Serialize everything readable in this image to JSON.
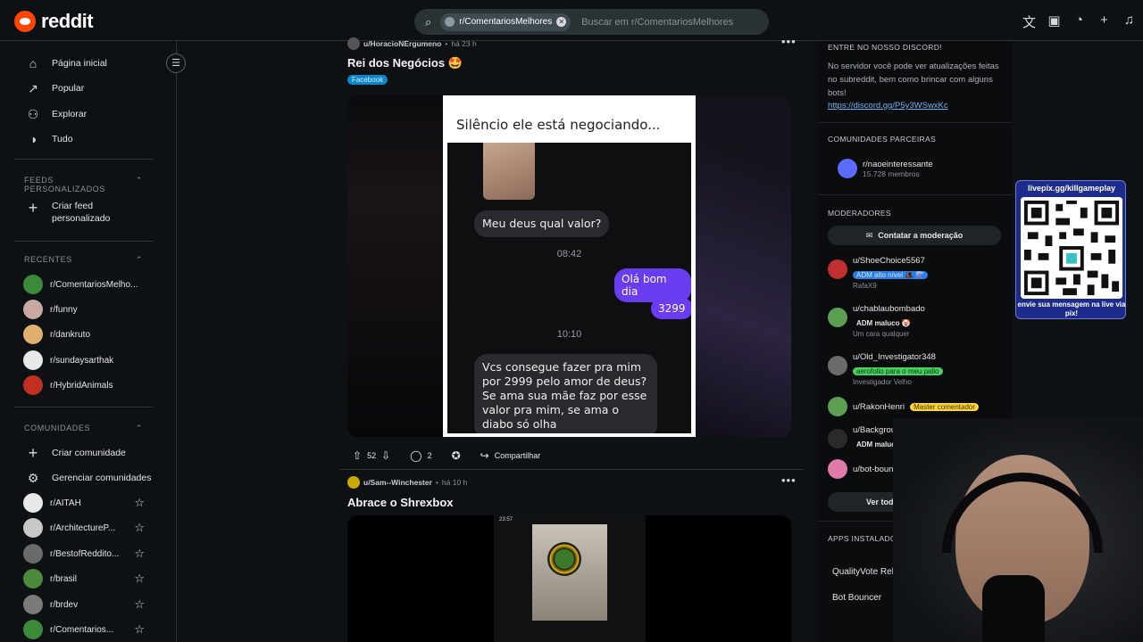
{
  "topbar": {
    "brand": "reddit",
    "search_chip": "r/ComentariosMelhores",
    "search_placeholder": "Buscar em r/ComentariosMelhores"
  },
  "sidebar": {
    "nav": [
      {
        "label": "Página inicial",
        "icon": "home-icon"
      },
      {
        "label": "Popular",
        "icon": "popular-icon"
      },
      {
        "label": "Explorar",
        "icon": "explore-icon"
      },
      {
        "label": "Tudo",
        "icon": "all-icon"
      }
    ],
    "feeds_title": "FEEDS PERSONALIZADOS",
    "create_feed": "Criar feed personalizado",
    "recent_title": "RECENTES",
    "recent": [
      {
        "label": "r/ComentariosMelho...",
        "color": "#3a8a3a"
      },
      {
        "label": "r/funny",
        "color": "#c8a8a0"
      },
      {
        "label": "r/dankruto",
        "color": "#e0b070"
      },
      {
        "label": "r/sundaysarthak",
        "color": "#e8e8e8"
      },
      {
        "label": "r/HybridAnimals",
        "color": "#c03020"
      }
    ],
    "communities_title": "COMUNIDADES",
    "create_community": "Criar comunidade",
    "manage_communities": "Gerenciar comunidades",
    "communities": [
      {
        "label": "r/AITAH",
        "color": "#e8e8e8"
      },
      {
        "label": "r/ArchitectureP...",
        "color": "#c8c8c8"
      },
      {
        "label": "r/BestofReddito...",
        "color": "#6a6a6a"
      },
      {
        "label": "r/brasil",
        "color": "#4a8a3a"
      },
      {
        "label": "r/brdev",
        "color": "#7a7a7a"
      },
      {
        "label": "r/Comentarios...",
        "color": "#3a8a3a"
      }
    ]
  },
  "posts": [
    {
      "user": "u/HoracioNErgumeno",
      "time": "há 23 h",
      "title": "Rei dos Negócios 🤩",
      "flair": "Facebook",
      "meme_caption": "Silêncio ele está negociando...",
      "chat": {
        "msg1": "Meu deus qual valor?",
        "time1": "08:42",
        "reply1": "Olá bom dia",
        "reply2": "3299",
        "time2": "10:10",
        "msg2": "Vcs consegue fazer pra mim por 2999 pelo amor de deus? Se ama sua mãe faz por esse valor pra mim, se ama o diabo só olha"
      },
      "votes": "52",
      "comments": "2",
      "share": "Compartilhar"
    },
    {
      "user": "u/Sam--Winchester",
      "time": "há 10 h",
      "title": "Abrace o Shrexbox",
      "status_time": "23:57"
    }
  ],
  "right": {
    "discord_title": "ENTRE NO NOSSO DISCORD!",
    "discord_text": "No servidor você pode ver atualizações feitas no subreddit, bem como brincar com alguns bots!",
    "discord_link": "https://discord.gg/P5y3WSwxKc",
    "partners_title": "COMUNIDADES PARCEIRAS",
    "partner_name": "r/naoeinteressante",
    "partner_members": "15.728 membros",
    "mods_title": "MODERADORES",
    "contact_mods": "Contatar a moderação",
    "mods": [
      {
        "name": "u/ShoeChoice5567",
        "flair": "ADM alto nível 🎩 ⚗️",
        "flair_bg": "#2b7de9",
        "flair_color": "#cfe4ff",
        "sub": "RafaX9",
        "color": "#c03030"
      },
      {
        "name": "u/chablaubombado",
        "flair": "ADM maluco 🤡",
        "flair_bg": "transparent",
        "flair_color": "#e3e6e8",
        "sub": "Um cara qualquer",
        "color": "#5aa050"
      },
      {
        "name": "u/Old_Investigator348",
        "flair": "aerofolio para o meu palio",
        "flair_bg": "#46d160",
        "flair_color": "#0a3a10",
        "sub": "Investigador Velho",
        "color": "#6a6a6a"
      },
      {
        "name": "u/RakonHenri",
        "flair": "Master comentador",
        "flair_bg": "#ffd635",
        "flair_color": "#3a3000",
        "sub": "",
        "color": "#5aa050"
      },
      {
        "name": "u/Background-Baby-9214",
        "flair": "ADM maluco 🤡",
        "flair_bg": "transparent",
        "flair_color": "#e3e6e8",
        "sub": "",
        "color": "#2a2a2a"
      },
      {
        "name": "u/bot-bouncer",
        "flair": "",
        "flair_bg": "transparent",
        "flair_color": "#e3e6e8",
        "sub": "",
        "color": "#e07aa8"
      }
    ],
    "all_mods": "Ver todos os moder  d res",
    "apps_title": "APPS INSTALADOS",
    "apps": [
      "QualityVote Reborn",
      "Bot Bouncer"
    ]
  },
  "overlay": {
    "qr_title": "livepix.gg/killgameplay",
    "qr_bottom": "envie sua mensagem na live via pix!"
  }
}
